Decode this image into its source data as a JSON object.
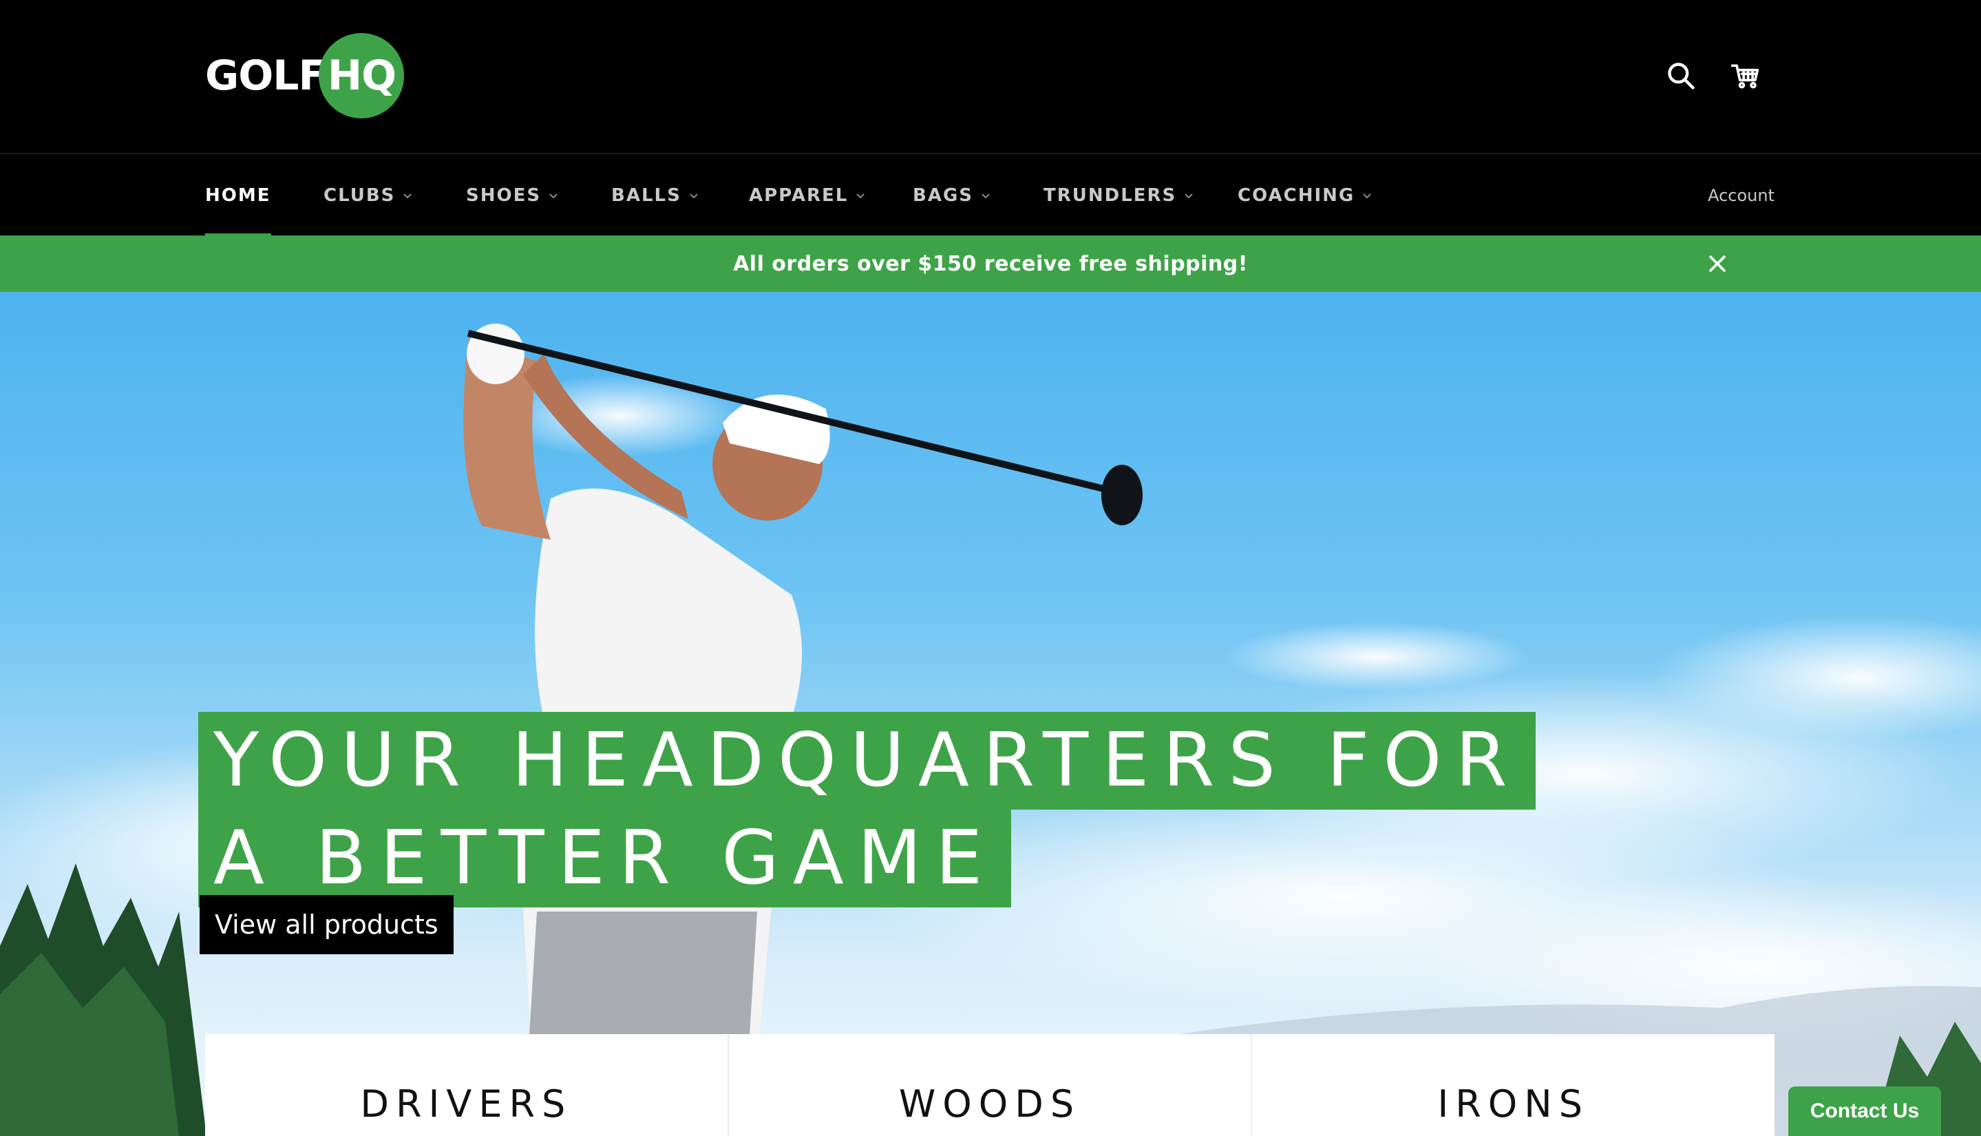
{
  "brand": {
    "logo_part1": "GOLF",
    "logo_part2": "HQ",
    "accent_color": "#3ea348"
  },
  "header": {
    "icons": [
      {
        "name": "search-icon"
      },
      {
        "name": "cart-icon"
      }
    ]
  },
  "nav": {
    "items": [
      {
        "label": "HOME",
        "active": true,
        "has_dropdown": false
      },
      {
        "label": "CLUBS",
        "active": false,
        "has_dropdown": true
      },
      {
        "label": "SHOES",
        "active": false,
        "has_dropdown": true
      },
      {
        "label": "BALLS",
        "active": false,
        "has_dropdown": true
      },
      {
        "label": "APPAREL",
        "active": false,
        "has_dropdown": true
      },
      {
        "label": "BAGS",
        "active": false,
        "has_dropdown": true
      },
      {
        "label": "TRUNDLERS",
        "active": false,
        "has_dropdown": true
      },
      {
        "label": "COACHING",
        "active": false,
        "has_dropdown": true
      }
    ],
    "account_label": "Account"
  },
  "announcement": {
    "text": "All orders over $150 receive free shipping!"
  },
  "hero": {
    "headline_line1": "YOUR HEADQUARTERS FOR",
    "headline_line2": "A BETTER GAME",
    "cta_label": "View all products"
  },
  "categories": [
    {
      "label": "DRIVERS"
    },
    {
      "label": "WOODS"
    },
    {
      "label": "IRONS"
    }
  ],
  "contact": {
    "label": "Contact Us"
  }
}
